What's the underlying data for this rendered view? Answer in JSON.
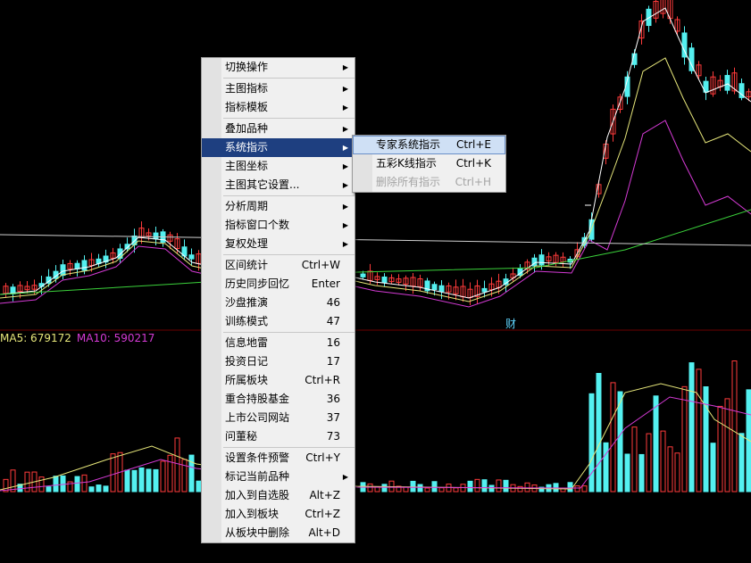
{
  "indicators": {
    "ma5_label": "MA5: 679172",
    "ma10_label": "MA10: 590217",
    "ma5_color": "#e6e67a",
    "ma10_color": "#d43ad4"
  },
  "marker": "财",
  "colors": {
    "up": "#ff3b3b",
    "down": "#54f0f0",
    "menu_highlight": "#1e3f80"
  },
  "context_menu": {
    "groups": [
      [
        {
          "label": "切换操作",
          "submenu": true
        }
      ],
      [
        {
          "label": "主图指标",
          "submenu": true
        },
        {
          "label": "指标模板",
          "submenu": true
        }
      ],
      [
        {
          "label": "叠加品种",
          "submenu": true
        },
        {
          "label": "系统指示",
          "submenu": true,
          "highlighted": true
        },
        {
          "label": "主图坐标",
          "submenu": true
        },
        {
          "label": "主图其它设置...",
          "submenu": true
        }
      ],
      [
        {
          "label": "分析周期",
          "submenu": true
        },
        {
          "label": "指标窗口个数",
          "submenu": true
        },
        {
          "label": "复权处理",
          "submenu": true
        }
      ],
      [
        {
          "label": "区间统计",
          "shortcut": "Ctrl+W"
        },
        {
          "label": "历史同步回忆",
          "shortcut": "Enter"
        },
        {
          "label": "沙盘推演",
          "shortcut": "46"
        },
        {
          "label": "训练模式",
          "shortcut": "47"
        }
      ],
      [
        {
          "label": "信息地雷",
          "shortcut": "16"
        },
        {
          "label": "投资日记",
          "shortcut": "17"
        },
        {
          "label": "所属板块",
          "shortcut": "Ctrl+R"
        },
        {
          "label": "重合持股基金",
          "shortcut": "36"
        },
        {
          "label": "上市公司网站",
          "shortcut": "37"
        },
        {
          "label": "问董秘",
          "shortcut": "73"
        }
      ],
      [
        {
          "label": "设置条件预警",
          "shortcut": "Ctrl+Y"
        },
        {
          "label": "标记当前品种",
          "submenu": true
        },
        {
          "label": "加入到自选股",
          "shortcut": "Alt+Z"
        },
        {
          "label": "加入到板块",
          "shortcut": "Ctrl+Z"
        },
        {
          "label": "从板块中删除",
          "shortcut": "Alt+D"
        }
      ]
    ]
  },
  "submenu": {
    "items": [
      {
        "label": "专家系统指示",
        "shortcut": "Ctrl+E",
        "highlighted": true
      },
      {
        "label": "五彩K线指示",
        "shortcut": "Ctrl+K"
      },
      {
        "label": "删除所有指示",
        "shortcut": "Ctrl+H",
        "disabled": true
      }
    ]
  }
}
